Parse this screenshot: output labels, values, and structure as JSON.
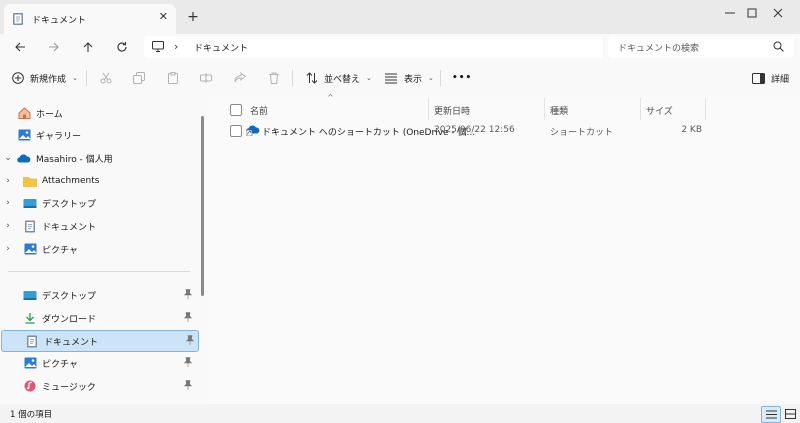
{
  "window": {
    "tab_title": "ドキュメント",
    "tab_icon": "documents-folder-icon",
    "tab_close": "✕",
    "new_tab": "+",
    "controls": [
      "minimize",
      "maximize",
      "close"
    ]
  },
  "navigation": {
    "breadcrumb_root_icon": "this-pc-icon",
    "breadcrumb_separator": "›",
    "breadcrumb": [
      "ドキュメント"
    ],
    "search_placeholder": "ドキュメントの検索"
  },
  "toolbar": {
    "new_label": "新規作成",
    "sort_label": "並べ替え",
    "view_label": "表示",
    "more_label": "•••",
    "details_label": "詳細",
    "disabled_actions": [
      "cut",
      "copy",
      "paste",
      "rename",
      "share",
      "delete"
    ]
  },
  "sidebar": {
    "top_items": [
      {
        "label": "ホーム",
        "icon": "home-icon"
      },
      {
        "label": "ギャラリー",
        "icon": "gallery-icon"
      }
    ],
    "onedrive": {
      "label": "Masahiro - 個人用",
      "icon": "onedrive-icon",
      "expanded": true
    },
    "onedrive_children": [
      {
        "label": "Attachments",
        "icon": "folder-icon"
      },
      {
        "label": "デスクトップ",
        "icon": "desktop-icon"
      },
      {
        "label": "ドキュメント",
        "icon": "documents-icon"
      },
      {
        "label": "ピクチャ",
        "icon": "pictures-icon"
      }
    ],
    "quick_access": [
      {
        "label": "デスクトップ",
        "icon": "desktop-icon",
        "pinned": true
      },
      {
        "label": "ダウンロード",
        "icon": "download-icon",
        "pinned": true
      },
      {
        "label": "ドキュメント",
        "icon": "documents-icon",
        "pinned": true,
        "selected": true
      },
      {
        "label": "ピクチャ",
        "icon": "pictures-icon",
        "pinned": true
      },
      {
        "label": "ミュージック",
        "icon": "music-icon",
        "pinned": true
      }
    ]
  },
  "file_list": {
    "sort_indicator": "^",
    "columns": [
      "名前",
      "更新日時",
      "種類",
      "サイズ"
    ],
    "rows": [
      {
        "name": "ドキュメント へのショートカット (OneDrive - 個...",
        "modified": "2025/06/22 12:56",
        "type": "ショートカット",
        "size": "2 KB",
        "icon": "onedrive-shortcut-icon"
      }
    ]
  },
  "status_bar": {
    "item_count": "1 個の項目",
    "active_view": "details"
  },
  "colors": {
    "selection_bg": "#cce4f7",
    "selection_border": "#7fb5e0",
    "accent": "#0067c0"
  }
}
